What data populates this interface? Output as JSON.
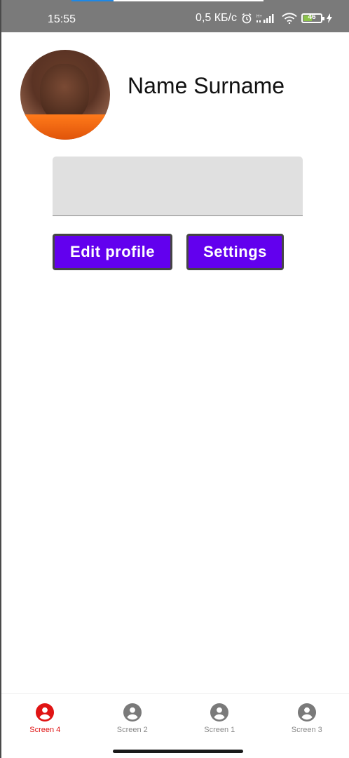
{
  "status_bar": {
    "time": "15:55",
    "speed": "0,5 КБ/с",
    "battery": "46"
  },
  "profile": {
    "name": "Name Surname",
    "text_field_value": ""
  },
  "buttons": {
    "edit_profile": "Edit profile",
    "settings": "Settings"
  },
  "bottom_nav": {
    "items": [
      {
        "label": "Screen 4",
        "icon": "account-circle-icon",
        "active": true
      },
      {
        "label": "Screen 2",
        "icon": "account-circle-icon",
        "active": false
      },
      {
        "label": "Screen 1",
        "icon": "account-circle-icon",
        "active": false
      },
      {
        "label": "Screen 3",
        "icon": "account-circle-icon",
        "active": false
      }
    ]
  },
  "colors": {
    "primary_button": "#6200ee",
    "active_nav": "#e01414",
    "inactive_nav": "#8a8a8a",
    "status_bar": "#7a7a7a"
  }
}
